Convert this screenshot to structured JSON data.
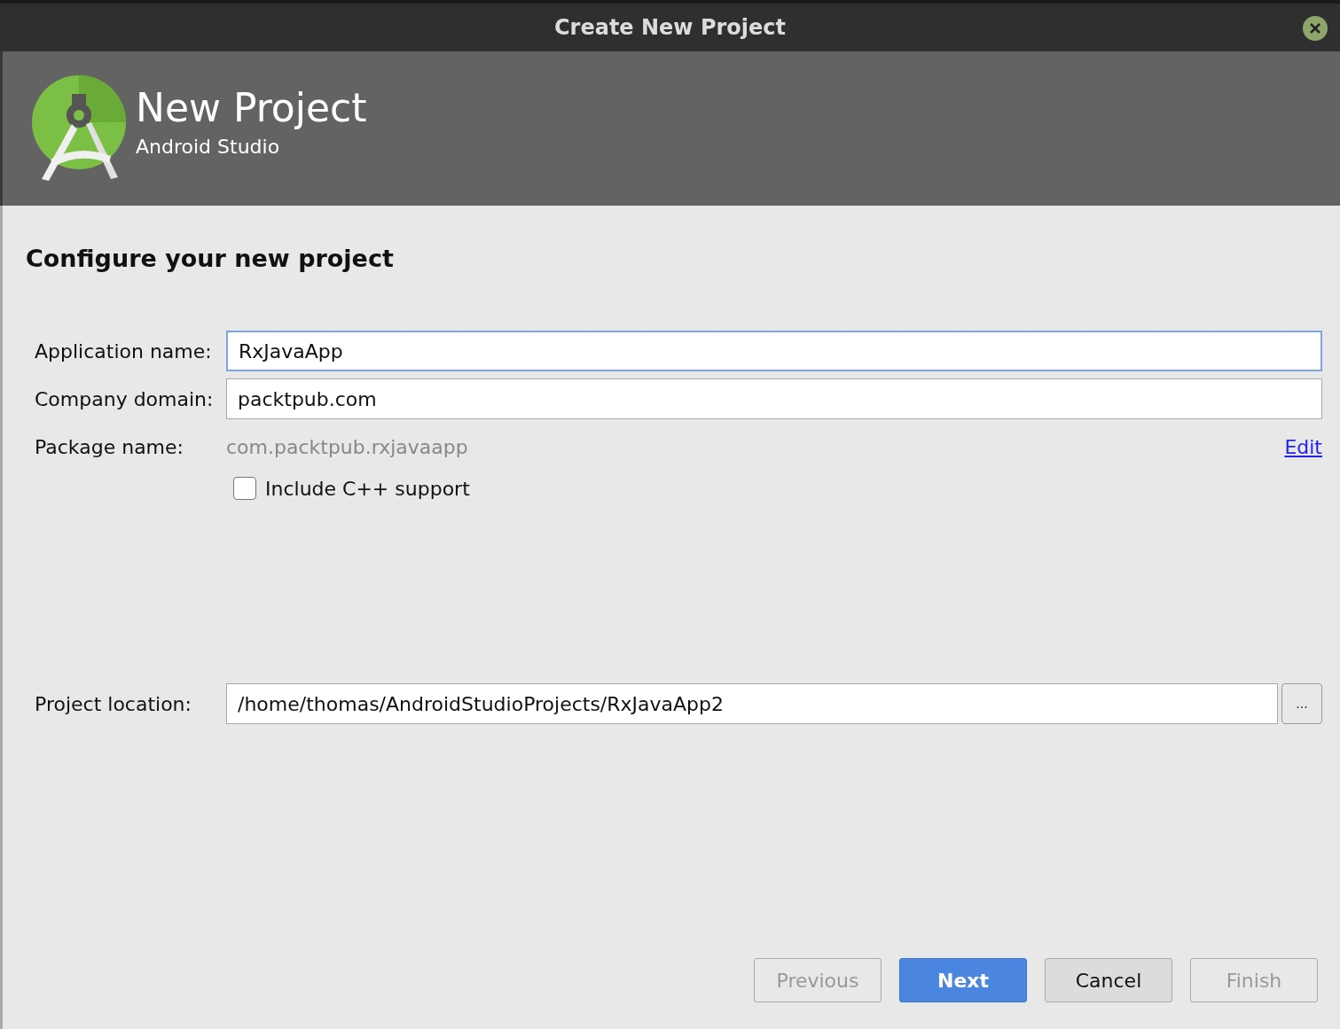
{
  "window": {
    "title": "Create New Project"
  },
  "header": {
    "title": "New Project",
    "subtitle": "Android Studio"
  },
  "heading": "Configure your new project",
  "fields": [
    {
      "label": "Application name:",
      "value": "RxJavaApp",
      "focused": true
    },
    {
      "label": "Company domain:",
      "value": "packtpub.com",
      "focused": false
    }
  ],
  "package": {
    "label": "Package name:",
    "value": "com.packtpub.rxjavaapp",
    "link": "Edit"
  },
  "cpp_support": {
    "label": "Include C++ support",
    "checked": false
  },
  "location": {
    "label": "Project location:",
    "value": "/home/thomas/AndroidStudioProjects/RxJavaApp2",
    "browse": "..."
  },
  "buttons": [
    {
      "label": "Previous",
      "disabled": true,
      "default": false
    },
    {
      "label": "Next",
      "disabled": false,
      "default": true
    },
    {
      "label": "Cancel",
      "disabled": false,
      "default": false
    },
    {
      "label": "Finish",
      "disabled": true,
      "default": false
    }
  ]
}
